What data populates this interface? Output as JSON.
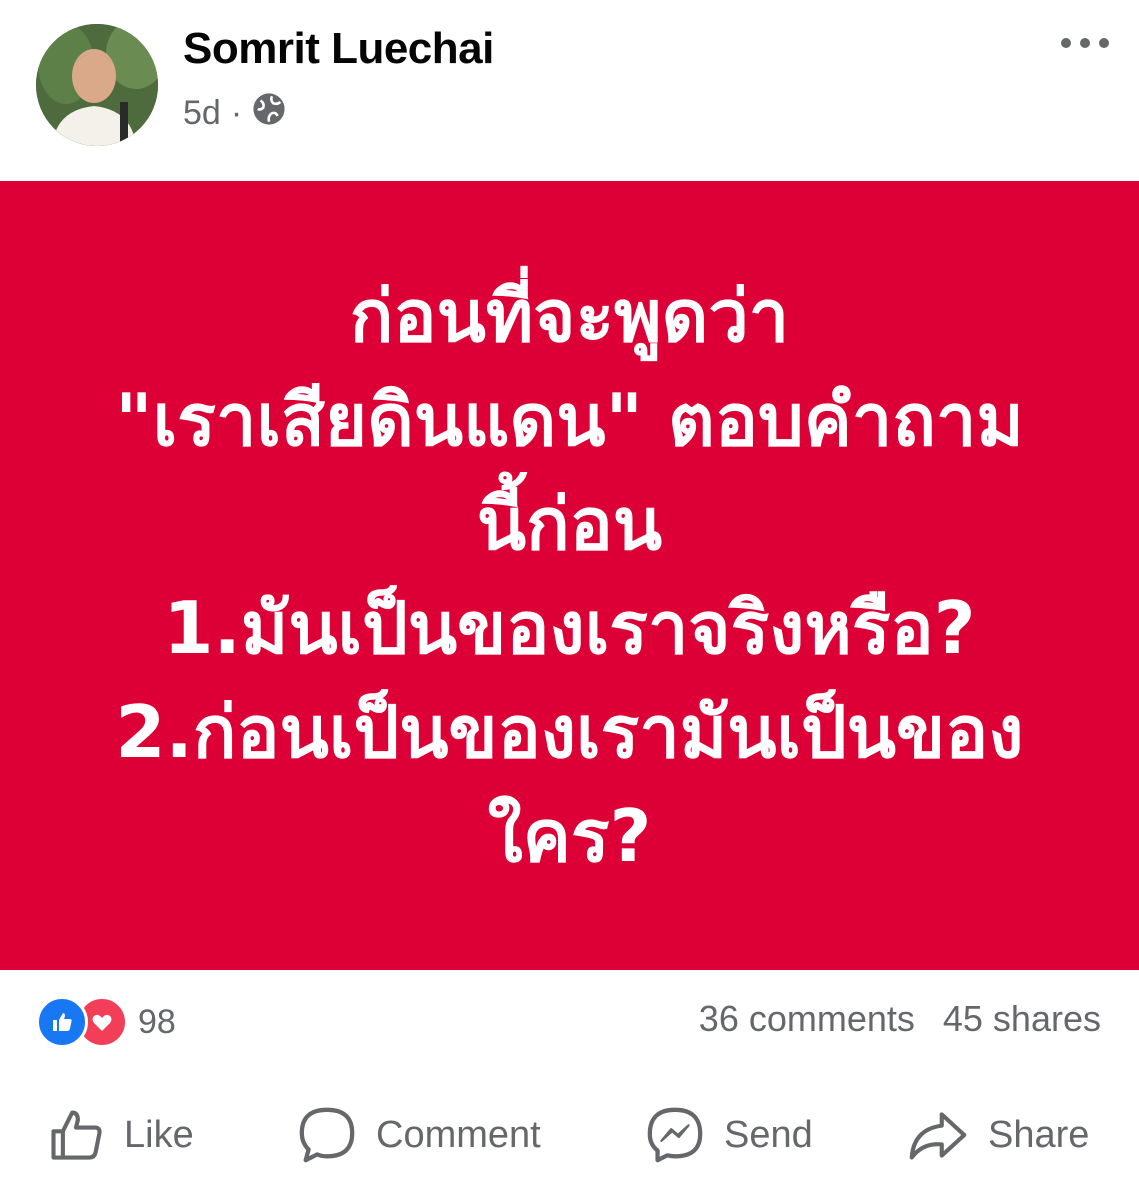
{
  "post": {
    "author": "Somrit Luechai",
    "time": "5d",
    "separator": "·",
    "privacy_icon": "globe-icon",
    "more_icon": "more-options-icon"
  },
  "image_text": {
    "line1": "ก่อนที่จะพูดว่า",
    "line2": "\"เราเสียดินแดน\" ตอบคำถาม",
    "line3": "นี้ก่อน",
    "line4": "1.มันเป็นของเราจริงหรือ?",
    "line5": "2.ก่อนเป็นของเรามันเป็นของ",
    "line6": "ใคร?"
  },
  "stats": {
    "reaction_count": "98",
    "comments": "36 comments",
    "shares": "45 shares"
  },
  "actions": {
    "like": "Like",
    "comment": "Comment",
    "send": "Send",
    "share": "Share"
  },
  "colors": {
    "image_background": "#dc0036",
    "like_blue": "#1877f2",
    "love_red": "#f33e58",
    "secondary_text": "#65676b"
  }
}
